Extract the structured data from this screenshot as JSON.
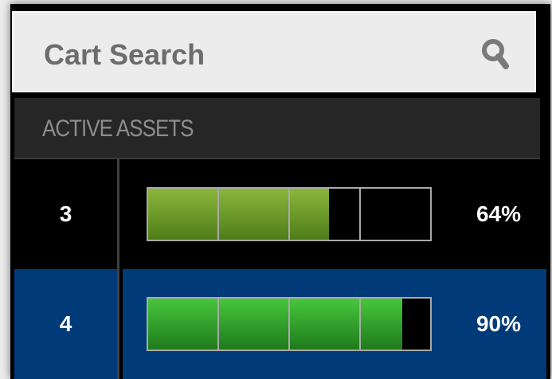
{
  "search": {
    "label": "Cart Search",
    "icon": "search-icon"
  },
  "section": {
    "label": "ACTIVE ASSETS"
  },
  "rows": [
    {
      "id": "3",
      "percent": "64%",
      "progress": 0.64,
      "color": "#6c9b2a",
      "selected": false
    },
    {
      "id": "4",
      "percent": "90%",
      "progress": 0.9,
      "color": "#2ea12a",
      "selected": true
    }
  ],
  "colors": {
    "selected_row": "#003a78",
    "header": "#262626",
    "panel": "#000000"
  }
}
